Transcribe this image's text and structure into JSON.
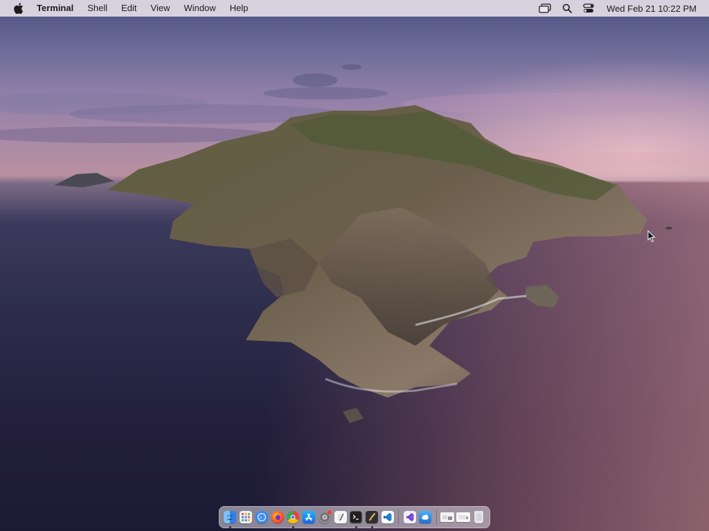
{
  "menubar": {
    "apple_icon": "apple-logo-icon",
    "app_name": "Terminal",
    "menus": [
      "Shell",
      "Edit",
      "View",
      "Window",
      "Help"
    ],
    "status_icons": [
      "screen-mirroring-icon",
      "spotlight-search-icon",
      "control-center-icon"
    ],
    "clock": "Wed Feb 21  10:22 PM"
  },
  "desktop": {
    "wallpaper": "macOS Catalina island"
  },
  "dock": {
    "apps": [
      {
        "name": "Finder",
        "icon": "finder-icon",
        "running": true,
        "color": "#3b8ef0"
      },
      {
        "name": "Launchpad",
        "icon": "launchpad-icon",
        "running": false,
        "color": "#e9e9ee"
      },
      {
        "name": "Safari",
        "icon": "safari-icon",
        "running": false,
        "color": "#2f8af5"
      },
      {
        "name": "Firefox",
        "icon": "firefox-icon",
        "running": false,
        "color": "#ff6a1a"
      },
      {
        "name": "Chrome",
        "icon": "chrome-icon",
        "running": true,
        "color": "#34a853"
      },
      {
        "name": "App Store",
        "icon": "app-store-icon",
        "running": false,
        "color": "#1d8cf5"
      },
      {
        "name": "System Preferences",
        "icon": "system-preferences-icon",
        "running": false,
        "color": "#8a8a8f"
      },
      {
        "name": "TextEdit",
        "icon": "textedit-icon",
        "running": false,
        "color": "#f4f4f4"
      },
      {
        "name": "Terminal",
        "icon": "terminal-icon",
        "running": true,
        "color": "#1f1f1f"
      },
      {
        "name": "Xcode Instruments",
        "icon": "paintbrush-app-icon",
        "running": true,
        "color": "#3a3a3a"
      },
      {
        "name": "Visual Studio Code",
        "icon": "vscode-icon",
        "running": false,
        "color": "#0d7bd4"
      }
    ],
    "apps2": [
      {
        "name": "Visual Studio",
        "icon": "visual-studio-icon",
        "running": false,
        "color": "#7b4ed9"
      },
      {
        "name": "Weather",
        "icon": "weather-icon",
        "running": false,
        "color": "#2e8de0"
      }
    ],
    "right": [
      {
        "name": "Downloads",
        "icon": "downloads-stack-icon"
      },
      {
        "name": "Documents",
        "icon": "documents-stack-icon"
      },
      {
        "name": "Trash",
        "icon": "trash-icon"
      }
    ]
  }
}
